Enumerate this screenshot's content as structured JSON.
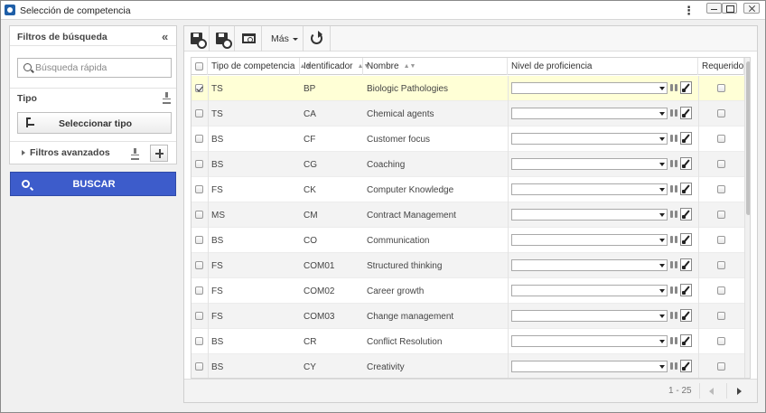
{
  "window": {
    "title": "Selección de competencia"
  },
  "filters": {
    "title": "Filtros de búsqueda",
    "search_placeholder": "Búsqueda rápida",
    "search_value": "",
    "tipo_label": "Tipo",
    "select_type_label": "Seleccionar tipo",
    "advanced_label": "Filtros avanzados",
    "search_button_label": "BUSCAR"
  },
  "toolbar": {
    "more_label": "Más"
  },
  "grid": {
    "columns": {
      "type": "Tipo de competencia",
      "id": "Identificador",
      "name": "Nombre",
      "level": "Nivel de proficiencia",
      "required": "Requerido"
    },
    "rows": [
      {
        "type": "TS",
        "id": "BP",
        "name": "Biologic Pathologies",
        "checked": true
      },
      {
        "type": "TS",
        "id": "CA",
        "name": "Chemical agents",
        "checked": false
      },
      {
        "type": "BS",
        "id": "CF",
        "name": "Customer focus",
        "checked": false
      },
      {
        "type": "BS",
        "id": "CG",
        "name": "Coaching",
        "checked": false
      },
      {
        "type": "FS",
        "id": "CK",
        "name": "Computer Knowledge",
        "checked": false
      },
      {
        "type": "MS",
        "id": "CM",
        "name": "Contract Management",
        "checked": false
      },
      {
        "type": "BS",
        "id": "CO",
        "name": "Communication",
        "checked": false
      },
      {
        "type": "FS",
        "id": "COM01",
        "name": "Structured thinking",
        "checked": false
      },
      {
        "type": "FS",
        "id": "COM02",
        "name": "Career growth",
        "checked": false
      },
      {
        "type": "FS",
        "id": "COM03",
        "name": "Change management",
        "checked": false
      },
      {
        "type": "BS",
        "id": "CR",
        "name": "Conflict Resolution",
        "checked": false
      },
      {
        "type": "BS",
        "id": "CY",
        "name": "Creativity",
        "checked": false
      }
    ]
  },
  "pager": {
    "range": "1 - 25"
  },
  "colors": {
    "accent": "#3d5ccb",
    "selected_row": "#ffffd6"
  }
}
